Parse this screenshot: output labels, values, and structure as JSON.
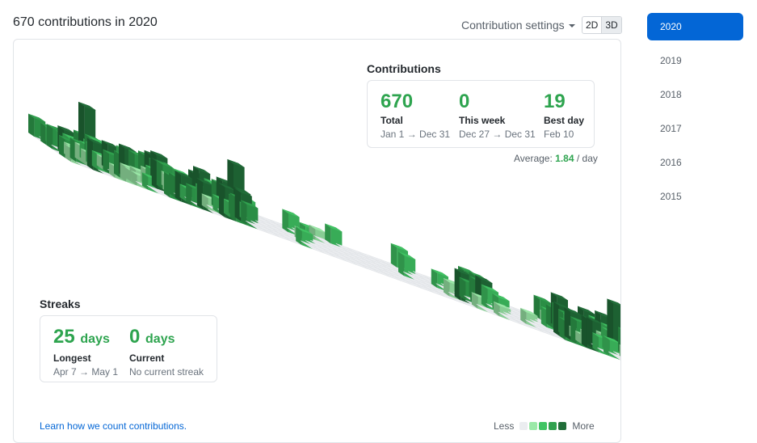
{
  "header": {
    "title": "670 contributions in 2020",
    "settings_label": "Contribution settings",
    "view_2d": "2D",
    "view_3d": "3D"
  },
  "contributions": {
    "heading": "Contributions",
    "total": {
      "value": "670",
      "label": "Total",
      "range": "Jan 1 → Dec 31"
    },
    "week": {
      "value": "0",
      "label": "This week",
      "range": "Dec 27 → Dec 31"
    },
    "best": {
      "value": "19",
      "label": "Best day",
      "range": "Feb 10"
    },
    "average_label": "Average:",
    "average_value": "1.84",
    "average_unit": "/ day"
  },
  "streaks": {
    "heading": "Streaks",
    "longest": {
      "value": "25",
      "unit": "days",
      "label": "Longest",
      "range": "Apr 7 → May 1"
    },
    "current": {
      "value": "0",
      "unit": "days",
      "label": "Current",
      "range": "No current streak"
    }
  },
  "footer": {
    "learn_link": "Learn how we count contributions.",
    "less": "Less",
    "more": "More"
  },
  "colors": {
    "empty": "#ebedf0",
    "level1": "#9be9a8",
    "level2": "#40c463",
    "level3": "#30a14e",
    "level4": "#216e39",
    "accent": "#2ea44f",
    "active_year": "#0366d6"
  },
  "years": [
    "2020",
    "2019",
    "2018",
    "2017",
    "2016",
    "2015"
  ],
  "selected_year": "2020"
}
